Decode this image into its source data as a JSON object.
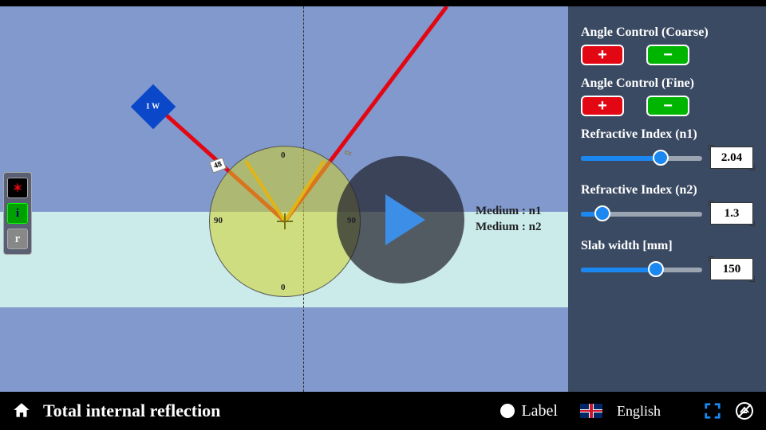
{
  "title": "Total internal reflection",
  "footer": {
    "label_toggle": "Label",
    "language": "English"
  },
  "source": {
    "power": "1 W"
  },
  "angles": {
    "incident_tag": "48",
    "reflected_tag": ""
  },
  "protractor": {
    "top": "0",
    "bottom": "0",
    "left": "90",
    "right": "90"
  },
  "medium_labels": {
    "n1": "Medium : n1",
    "n2": "Medium : n2"
  },
  "controls": {
    "coarse_label": "Angle Control (Coarse)",
    "fine_label": "Angle Control (Fine)",
    "plus": "+",
    "minus": "−",
    "n1_label": "Refractive Index (n1)",
    "n1_value": "2.04",
    "n1_percent": 66,
    "n2_label": "Refractive Index (n2)",
    "n2_value": "1.3",
    "n2_percent": 18,
    "slab_label": "Slab width [mm]",
    "slab_value": "150",
    "slab_percent": 62
  },
  "toolbox": {
    "laser": "✶",
    "info": "i",
    "reset": "r"
  }
}
